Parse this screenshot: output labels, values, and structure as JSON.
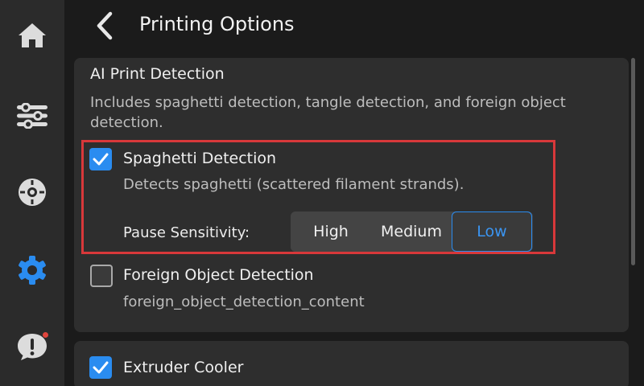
{
  "header": {
    "title": "Printing Options"
  },
  "sidebar": {
    "items": [
      {
        "icon": "home-icon"
      },
      {
        "icon": "sliders-icon"
      },
      {
        "icon": "filament-spool-icon"
      },
      {
        "icon": "gear-icon",
        "active": true
      },
      {
        "icon": "alert-bubble-icon",
        "has_notification": true
      }
    ]
  },
  "ai_detection": {
    "title": "AI Print Detection",
    "description": "Includes spaghetti detection, tangle detection, and foreign object detection.",
    "spaghetti": {
      "label": "Spaghetti Detection",
      "checked": true,
      "description": "Detects spaghetti (scattered filament strands).",
      "sensitivity_label": "Pause Sensitivity:",
      "options": [
        "High",
        "Medium",
        "Low"
      ],
      "selected": "Low"
    },
    "foreign_object": {
      "label": "Foreign Object Detection",
      "checked": false,
      "description": "foreign_object_detection_content"
    }
  },
  "extruder_cooler": {
    "label": "Extruder Cooler",
    "checked": true
  },
  "colors": {
    "accent": "#2a8cf0",
    "highlight_border": "#d8383a",
    "notification": "#e0453d",
    "card_bg": "#2e2e2e",
    "sidebar_bg": "#2b2b2b"
  }
}
